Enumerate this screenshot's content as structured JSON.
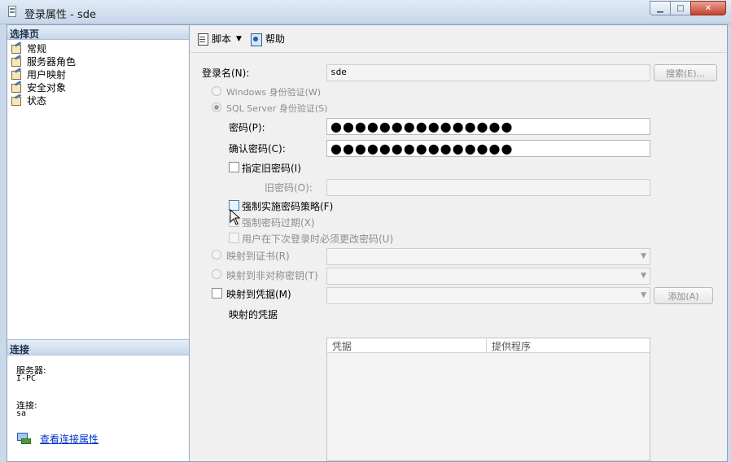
{
  "window": {
    "title": "登录属性 - sde",
    "controls": {
      "minimize": "▁",
      "maximize": "□",
      "close": "✕"
    }
  },
  "left_panel": {
    "header": "选择页",
    "pages": [
      {
        "label": "常规",
        "icon": "page-icon"
      },
      {
        "label": "服务器角色",
        "icon": "page-icon"
      },
      {
        "label": "用户映射",
        "icon": "page-icon"
      },
      {
        "label": "安全对象",
        "icon": "page-icon"
      },
      {
        "label": "状态",
        "icon": "page-icon"
      }
    ],
    "connection": {
      "header": "连接",
      "server_label": "服务器:",
      "server_value": "I-PC",
      "connection_label": "连接:",
      "connection_value": "sa",
      "view_props_link": "查看连接属性",
      "link_icon": "connection-properties-icon"
    }
  },
  "toolbar": {
    "script_label": "脚本",
    "script_dropdown": "▼",
    "help_label": "帮助"
  },
  "form": {
    "login_name_label": "登录名(N):",
    "login_name_value": "sde",
    "search_button": "搜索(E)...",
    "windows_auth_label": "Windows 身份验证(W)",
    "sql_auth_label": "SQL Server 身份验证(S)",
    "password_label": "密码(P):",
    "password_value": "●●●●●●●●●●●●●●●",
    "confirm_password_label": "确认密码(C):",
    "confirm_password_value": "●●●●●●●●●●●●●●●",
    "specify_old_password_label": "指定旧密码(I)",
    "old_password_label": "旧密码(O):",
    "enforce_policy_label": "强制实施密码策略(F)",
    "enforce_expiration_label": "强制密码过期(X)",
    "must_change_label": "用户在下次登录时必须更改密码(U)",
    "map_certificate_label": "映射到证书(R)",
    "map_asymmetric_key_label": "映射到非对称密钥(T)",
    "map_credential_label": "映射到凭据(M)",
    "add_button": "添加(A)",
    "mapped_credentials_label": "映射的凭据",
    "credentials_columns": [
      "凭据",
      "提供程序"
    ]
  }
}
